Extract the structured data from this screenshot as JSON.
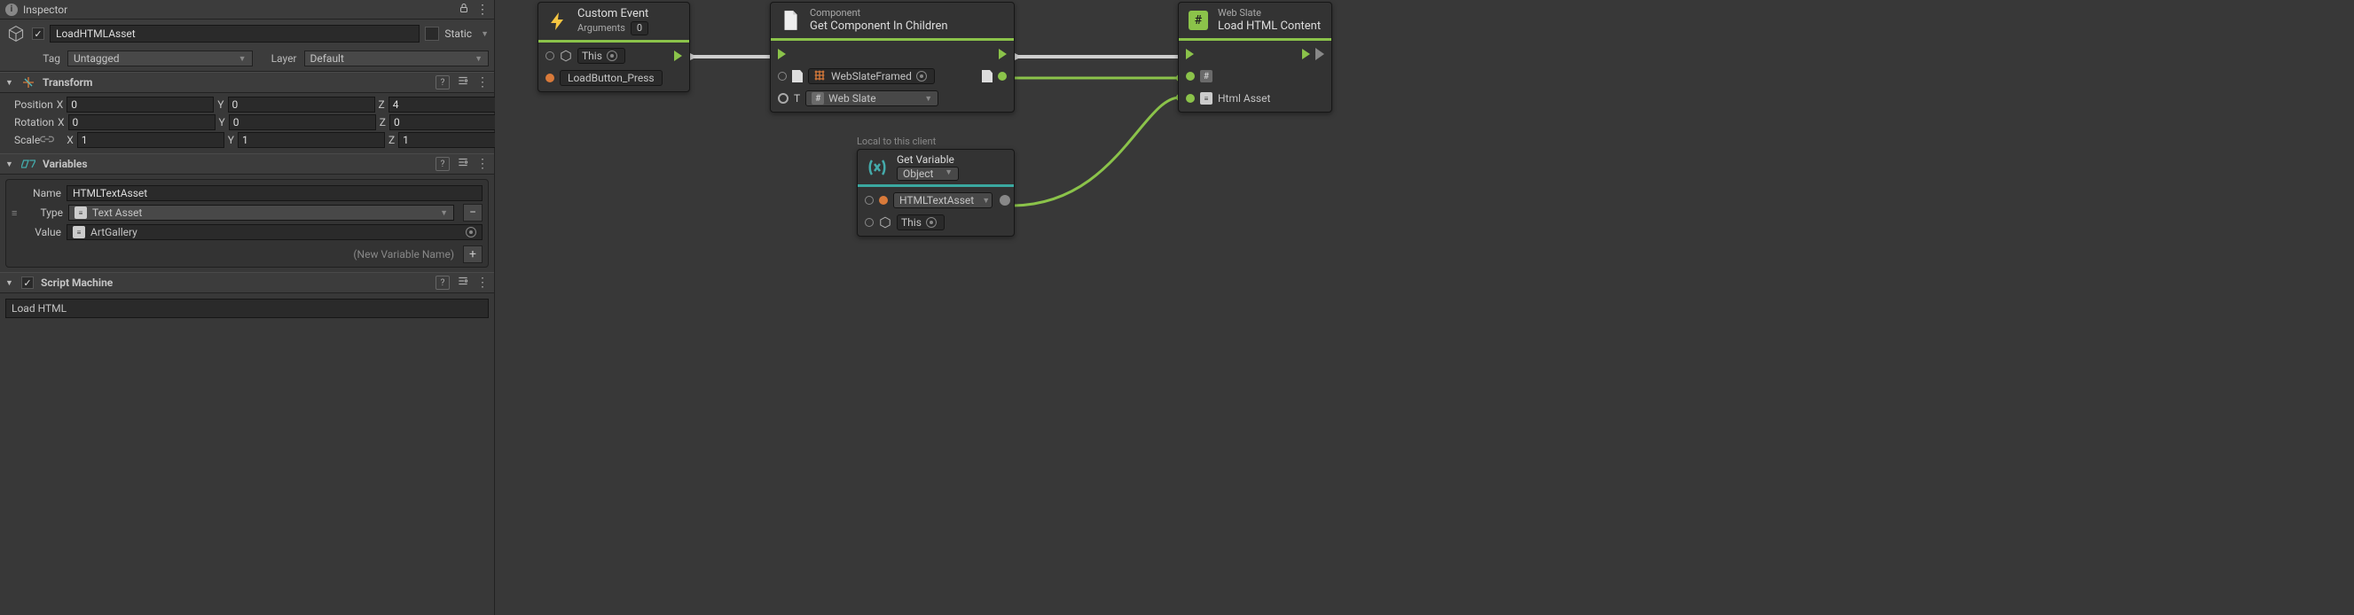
{
  "inspector": {
    "title": "Inspector",
    "go": {
      "enabled": true,
      "name": "LoadHTMLAsset",
      "static_label": "Static",
      "tag_label": "Tag",
      "tag_value": "Untagged",
      "layer_label": "Layer",
      "layer_value": "Default"
    },
    "transform": {
      "title": "Transform",
      "position_label": "Position",
      "rotation_label": "Rotation",
      "scale_label": "Scale",
      "x_label": "X",
      "y_label": "Y",
      "z_label": "Z",
      "position": {
        "x": "0",
        "y": "0",
        "z": "4"
      },
      "rotation": {
        "x": "0",
        "y": "0",
        "z": "0"
      },
      "scale": {
        "x": "1",
        "y": "1",
        "z": "1"
      }
    },
    "variables": {
      "title": "Variables",
      "name_label": "Name",
      "type_label": "Type",
      "value_label": "Value",
      "name_value": "HTMLTextAsset",
      "type_value": "Text Asset",
      "value_value": "ArtGallery",
      "new_placeholder": "(New Variable Name)"
    },
    "script_machine": {
      "title": "Script Machine",
      "enabled": true,
      "graph_name": "Load HTML"
    }
  },
  "graph": {
    "nodes": {
      "custom_event": {
        "title": "Custom Event",
        "arguments_label": "Arguments",
        "arguments_value": "0",
        "target_label": "This",
        "event_name": "LoadButton_Press"
      },
      "get_component": {
        "subtitle": "Component",
        "title": "Get Component In Children",
        "object_value": "WebSlateFramed",
        "t_label": "T",
        "t_value": "Web Slate"
      },
      "get_variable": {
        "local_hint": "Local to this client",
        "title": "Get Variable",
        "kind_value": "Object",
        "var_value": "HTMLTextAsset",
        "target_label": "This"
      },
      "load_html": {
        "subtitle": "Web Slate",
        "title": "Load HTML Content",
        "input_label": "Html Asset"
      }
    },
    "colors": {
      "flow": "#cfcfcf",
      "data_green": "#8bc34a",
      "bar_teal": "#3aa8a0"
    }
  }
}
